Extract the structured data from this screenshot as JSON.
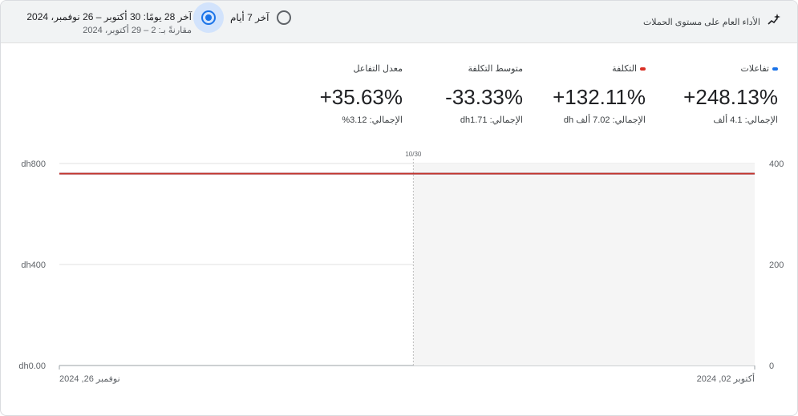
{
  "header": {
    "title": "الأداء العام على مستوى الحملات",
    "option_7_days": "آخر 7 أيام",
    "option_28_days": "آخر 28 يومًا: 30 أكتوبر – 26 نوفمبر، 2024",
    "option_28_compare": "مقارنةً بـ: 2 – 29 أكتوبر، 2024",
    "selected_option": "28_days"
  },
  "metrics": [
    {
      "label": "تفاعلات",
      "value": "+248.13%",
      "total": "الإجمالي: 4.1 ألف",
      "color": "#1a73e8"
    },
    {
      "label": "التكلفة",
      "value": "+132.11%",
      "total": "الإجمالي: 7.02 ألف dh",
      "color": "#d93025"
    },
    {
      "label": "متوسط التكلفة",
      "value": "-33.33%",
      "total": "الإجمالي: dh1.71",
      "color": ""
    },
    {
      "label": "معدل التفاعل",
      "value": "+35.63%",
      "total": "الإجمالي: 3.12%",
      "color": ""
    }
  ],
  "chart_data": {
    "type": "line",
    "x_axis_start_label": "أكتوبر 02, 2024",
    "x_axis_end_label": "نوفمبر 26, 2024",
    "marker_label": "10/30",
    "left_axis": {
      "ticks": [
        "dh0.00",
        "dh400",
        "dh800"
      ],
      "ylim": [
        0,
        800
      ]
    },
    "right_axis": {
      "ticks": [
        "0",
        "200",
        "400"
      ],
      "ylim": [
        0,
        400
      ]
    },
    "grid": true,
    "series": [
      {
        "name": "التكلفة",
        "axis": "left",
        "color": "#c5362c",
        "values": [
          760,
          760,
          760,
          760,
          760,
          760,
          760,
          760,
          760,
          760,
          760,
          760,
          760,
          760,
          760,
          760,
          760,
          760,
          760,
          760,
          760,
          760,
          760,
          760,
          760,
          760,
          760,
          760,
          760,
          760,
          760,
          760,
          760,
          760,
          760,
          760,
          760,
          760,
          760,
          760,
          760,
          760,
          760,
          760,
          760,
          760,
          760,
          760,
          760,
          760,
          760,
          760,
          760,
          760,
          760,
          760
        ]
      },
      {
        "name": "تفاعلات",
        "axis": "right",
        "color": "#1a73e8",
        "values": [
          380,
          380,
          380,
          380,
          380,
          380,
          380,
          380,
          380,
          380,
          380,
          380,
          380,
          380,
          380,
          380,
          380,
          380,
          380,
          380,
          380,
          380,
          380,
          380,
          380,
          380,
          380,
          380,
          380,
          380,
          380,
          380,
          380,
          380,
          380,
          380,
          380,
          380,
          380,
          380,
          380,
          380,
          380,
          380,
          380,
          380,
          380,
          380,
          380,
          380,
          380,
          380,
          380,
          380,
          380,
          380
        ]
      }
    ]
  }
}
